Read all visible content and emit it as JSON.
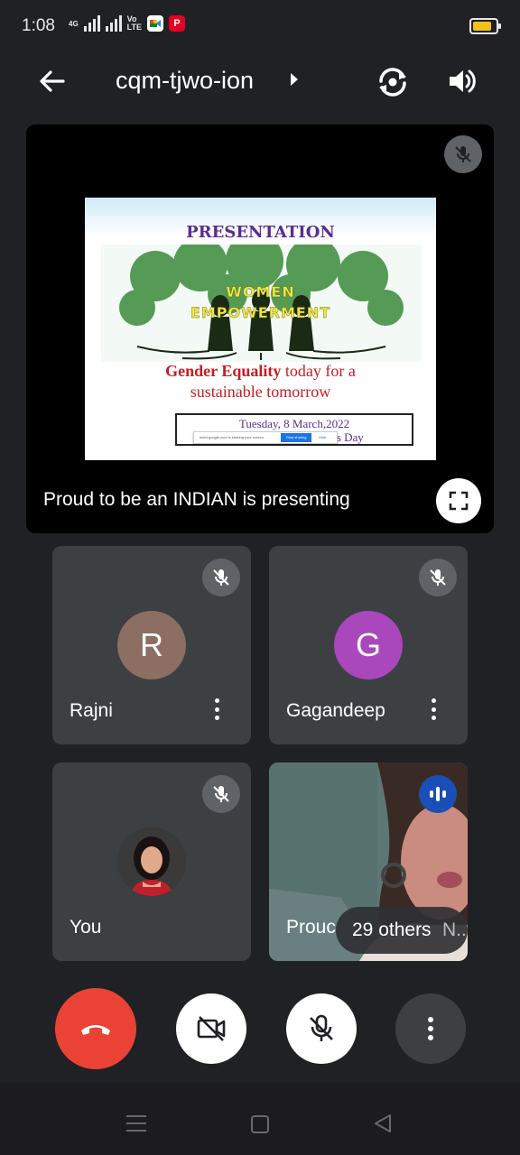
{
  "status_bar": {
    "time": "1:08",
    "network_4g": "4G",
    "volte": "Vo\nLTE",
    "battery_color": "#f2c21b"
  },
  "header": {
    "meeting_code": "cqm-tjwo-ion"
  },
  "presentation": {
    "slide": {
      "title": "PRESENTATION",
      "line_women": "WOMEN",
      "line_empowerment": "EMPOWERMENT",
      "gender_bold": "Gender Equality",
      "gender_rest": " today for a",
      "sustainable": "sustainable tomorrow",
      "date": "Tuesday, 8 March,2022",
      "day_fragment": "n's Day",
      "share_message": "meet.google.com is sharing your screen.",
      "stop_sharing": "Stop sharing",
      "hide": "Hide"
    },
    "presenter_text": "Proud to be an INDIAN is presenting"
  },
  "participants": [
    {
      "name": "Rajni",
      "initial": "R",
      "avatar_color": "#8d6e63",
      "muted": true
    },
    {
      "name": "Gagandeep",
      "initial": "G",
      "avatar_color": "#ab47bc",
      "muted": true
    },
    {
      "name": "You",
      "muted": true
    },
    {
      "name": "Prouc",
      "name_fragment_tail": "N...",
      "others_label": "29 others",
      "speaking": true
    }
  ],
  "colors": {
    "end_call": "#ea4335",
    "speaking_badge": "#1a4fb5",
    "tile_bg": "#3c4043",
    "app_bg": "#202124"
  }
}
